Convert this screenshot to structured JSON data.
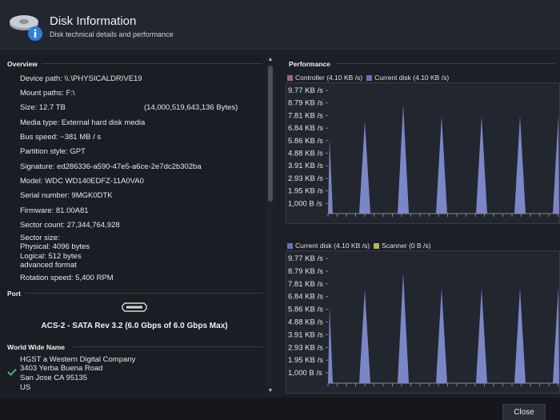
{
  "header": {
    "title": "Disk Information",
    "subtitle": "Disk technical details and performance",
    "icon": "disk-info-icon"
  },
  "overview": {
    "heading": "Overview",
    "device_path": "Device path: \\\\.\\PHYSICALDRIVE19",
    "mount_paths": "Mount paths: F:\\",
    "size": "Size: 12.7 TB",
    "size_bytes": "(14,000,519,643,136 Bytes)",
    "media_type": "Media type: External hard disk media",
    "bus_speed": "Bus speed: ~381 MB / s",
    "partition_style": "Partition style: GPT",
    "signature": "Signature: ed286336-a590-47e5-a6ce-2e7dc2b302ba",
    "model": "Model: WDC WD140EDFZ-11A0VA0",
    "serial": "Serial number: 9MGK0DTK",
    "firmware": "Firmware: 81.00A81",
    "sector_count": "Sector count: 27,344,764,928",
    "sector_size_label": "Sector size:",
    "sector_physical": "Physical: 4096 bytes",
    "sector_logical": "Logical: 512 bytes",
    "sector_format": "advanced format",
    "rotation_speed": "Rotation speed: 5,400 RPM"
  },
  "port": {
    "heading": "Port",
    "value": "ACS-2 - SATA Rev 3.2 (6.0 Gbps of 6.0 Gbps Max)"
  },
  "wwn": {
    "heading": "World Wide Name",
    "line1": "HGST a Western Digital Company",
    "line2": "3403 Yerba Buena Road",
    "line3": "San Jose  CA  95135",
    "line4": "US"
  },
  "performance": {
    "heading": "Performance"
  },
  "colors": {
    "controller": "#a0648c",
    "current_disk": "#6474b4",
    "scanner": "#b4b464",
    "spike_fill": "#7b86c8",
    "grid": "#30353e"
  },
  "chart_data": [
    {
      "type": "area",
      "series": [
        {
          "name": "Controller (4.10 KB /s)",
          "values": [
            0,
            0,
            0,
            0,
            0,
            0,
            0,
            0,
            0,
            0,
            0,
            0,
            0,
            0,
            0,
            0,
            0,
            0,
            0,
            0,
            0,
            0,
            0,
            0,
            0,
            0,
            0,
            0,
            0,
            0,
            0,
            0,
            0,
            0,
            0,
            0,
            0,
            0,
            0,
            0,
            0,
            0,
            0,
            0,
            0,
            0,
            0,
            0,
            0,
            0,
            0,
            0,
            0,
            0,
            0,
            0,
            0,
            0,
            0,
            0,
            0,
            0,
            0,
            0,
            0,
            0,
            0,
            0,
            0,
            0,
            0,
            0,
            0,
            0,
            0,
            0,
            0,
            0,
            0,
            0,
            0,
            0,
            0,
            0,
            0,
            0,
            0,
            0,
            0,
            0,
            0,
            0
          ]
        },
        {
          "name": "Current disk (4.10 KB /s)",
          "values": [
            0.5,
            0.5,
            1.5,
            3,
            4,
            5.86,
            4,
            3,
            2,
            1,
            0,
            0,
            0,
            0,
            0,
            0,
            0,
            0,
            0,
            0,
            0,
            0,
            0,
            0,
            0,
            0,
            0,
            0,
            0,
            0,
            0,
            0,
            0,
            0,
            0,
            0,
            0,
            0,
            0,
            0,
            0,
            0,
            0,
            0,
            0,
            0,
            0,
            0,
            0,
            0,
            0,
            0,
            0,
            0,
            0,
            0,
            0,
            0,
            0,
            0,
            0,
            0,
            0,
            0,
            0,
            0,
            0,
            0,
            0,
            0,
            0,
            0,
            0,
            0,
            0,
            0,
            0,
            0,
            0,
            0,
            0,
            0,
            0,
            0,
            0,
            0,
            0,
            0,
            0,
            0,
            0,
            0
          ]
        }
      ],
      "peaks": [
        {
          "x": 2,
          "y": 5.86
        },
        {
          "x": 46,
          "y": 7.2
        },
        {
          "x": 94,
          "y": 8.5
        },
        {
          "x": 142,
          "y": 7.6
        },
        {
          "x": 192,
          "y": 7.6
        },
        {
          "x": 240,
          "y": 7.6
        },
        {
          "x": 288,
          "y": 7.7
        }
      ],
      "y_ticks": [
        "1,000 B /s",
        "1.95 KB /s",
        "2.93 KB /s",
        "3.91 KB /s",
        "4.88 KB /s",
        "5.86 KB /s",
        "6.84 KB /s",
        "7.81 KB /s",
        "8.79 KB /s",
        "9.77 KB /s"
      ],
      "ylim": [
        0,
        9.77
      ],
      "grid": true,
      "legend": "top-left"
    },
    {
      "type": "area",
      "series": [
        {
          "name": "Current disk (4.10 KB /s)"
        },
        {
          "name": "Scanner (0 B /s)"
        }
      ],
      "peaks": [
        {
          "x": 2,
          "y": 5.86
        },
        {
          "x": 46,
          "y": 7.2
        },
        {
          "x": 94,
          "y": 8.5
        },
        {
          "x": 142,
          "y": 7.3
        },
        {
          "x": 192,
          "y": 7.3
        },
        {
          "x": 240,
          "y": 7.3
        },
        {
          "x": 288,
          "y": 7.5
        }
      ],
      "y_ticks": [
        "1,000 B /s",
        "1.95 KB /s",
        "2.93 KB /s",
        "3.91 KB /s",
        "4.88 KB /s",
        "5.86 KB /s",
        "6.84 KB /s",
        "7.81 KB /s",
        "8.79 KB /s",
        "9.77 KB /s"
      ],
      "ylim": [
        0,
        9.77
      ],
      "grid": true,
      "legend": "top-left"
    }
  ],
  "footer": {
    "close_label": "Close"
  }
}
